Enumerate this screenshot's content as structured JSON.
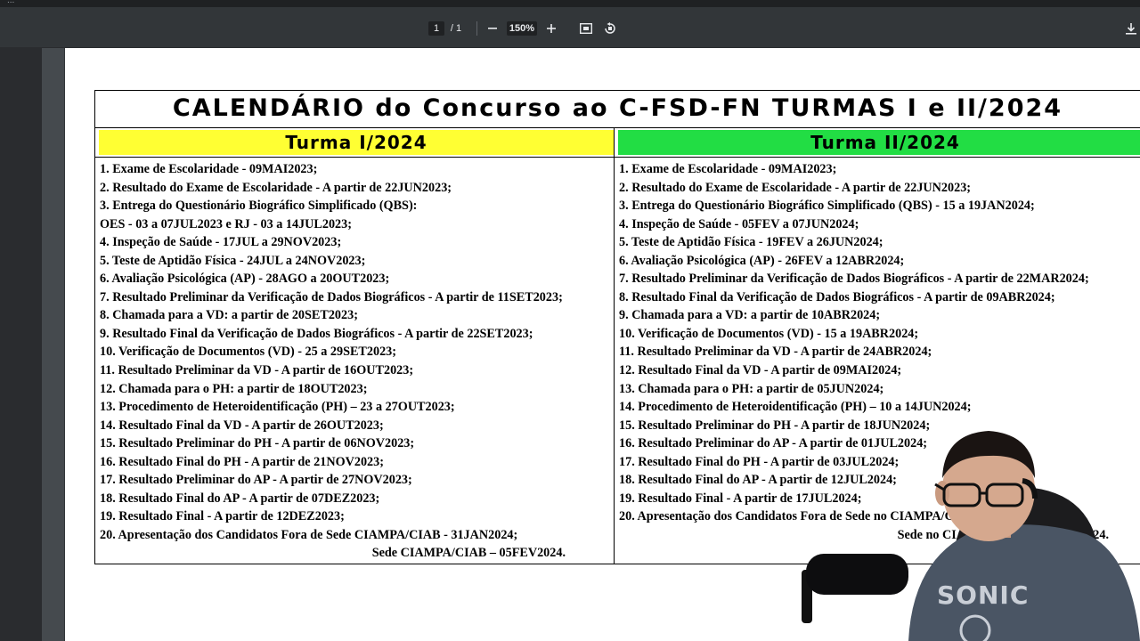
{
  "viewer": {
    "url_fragment": "...",
    "page_current": "1",
    "page_sep": "/ 1",
    "zoom": "150%"
  },
  "document": {
    "title": "CALENDÁRIO do Concurso ao C-FSD-FN TURMAS I e II/2024",
    "turma1": {
      "header": "Turma I/2024",
      "lines": [
        "1. Exame de Escolaridade - 09MAI2023;",
        "2. Resultado do Exame de Escolaridade - A partir de 22JUN2023;",
        "3. Entrega do Questionário Biográfico Simplificado (QBS):",
        "OES - 03 a 07JUL2023 e RJ - 03 a 14JUL2023;",
        "4. Inspeção de Saúde - 17JUL a 29NOV2023;",
        "5. Teste de Aptidão Física - 24JUL a 24NOV2023;",
        "6. Avaliação Psicológica (AP) - 28AGO a 20OUT2023;",
        "7. Resultado Preliminar da Verificação de Dados Biográficos - A partir de 11SET2023;",
        "8. Chamada para a VD: a partir de 20SET2023;",
        "9. Resultado Final da Verificação de Dados Biográficos - A partir de 22SET2023;",
        "10. Verificação de Documentos (VD) - 25 a 29SET2023;",
        "11. Resultado Preliminar da VD - A partir de 16OUT2023;",
        "12. Chamada para o PH: a partir de 18OUT2023;",
        "13. Procedimento de Heteroidentificação (PH) – 23 a 27OUT2023;",
        "14. Resultado Final da VD - A partir de 26OUT2023;",
        "15. Resultado Preliminar do PH - A partir de 06NOV2023;",
        "16. Resultado Final do PH - A partir de 21NOV2023;",
        "17. Resultado Preliminar do AP - A partir de 27NOV2023;",
        "18. Resultado Final do AP - A partir de 07DEZ2023;",
        "19. Resultado Final - A partir de 12DEZ2023;",
        "20. Apresentação dos Candidatos Fora de Sede CIAMPA/CIAB - 31JAN2024;"
      ],
      "last_line": "Sede CIAMPA/CIAB – 05FEV2024."
    },
    "turma2": {
      "header": "Turma II/2024",
      "lines": [
        "1. Exame de Escolaridade - 09MAI2023;",
        "2. Resultado do Exame de Escolaridade - A partir de 22JUN2023;",
        "3. Entrega do Questionário Biográfico Simplificado (QBS) - 15 a 19JAN2024;",
        "4. Inspeção de Saúde - 05FEV a 07JUN2024;",
        "5. Teste de Aptidão Física - 19FEV a 26JUN2024;",
        "6. Avaliação Psicológica (AP) - 26FEV a 12ABR2024;",
        "7. Resultado Preliminar da Verificação de Dados Biográficos - A partir de 22MAR2024;",
        "8. Resultado Final da Verificação de Dados Biográficos - A partir de 09ABR2024;",
        "9. Chamada para a VD: a partir de 10ABR2024;",
        "10. Verificação de Documentos (VD) - 15 a 19ABR2024;",
        "11. Resultado Preliminar da VD - A partir de 24ABR2024;",
        "12. Resultado Final da VD - A partir de 09MAI2024;",
        "13. Chamada para o PH: a partir de 05JUN2024;",
        "14. Procedimento de Heteroidentificação (PH) – 10 a 14JUN2024;",
        "15. Resultado Preliminar do PH - A partir de 18JUN2024;",
        "16. Resultado Preliminar do AP - A partir de 01JUL2024;",
        "17. Resultado Final do PH - A partir de 03JUL2024;",
        "18. Resultado Final do AP - A partir de 12JUL2024;",
        "19. Resultado Final - A partir de 17JUL2024;",
        "20. Apresentação dos Candidatos Fora de Sede no CIAMPA/CIAB - 31JUL2024;"
      ],
      "last_line": "Sede no CIAMPA/CIAB - 05AGO2024."
    }
  },
  "overlay": {
    "shirt_text": "SONIC"
  }
}
